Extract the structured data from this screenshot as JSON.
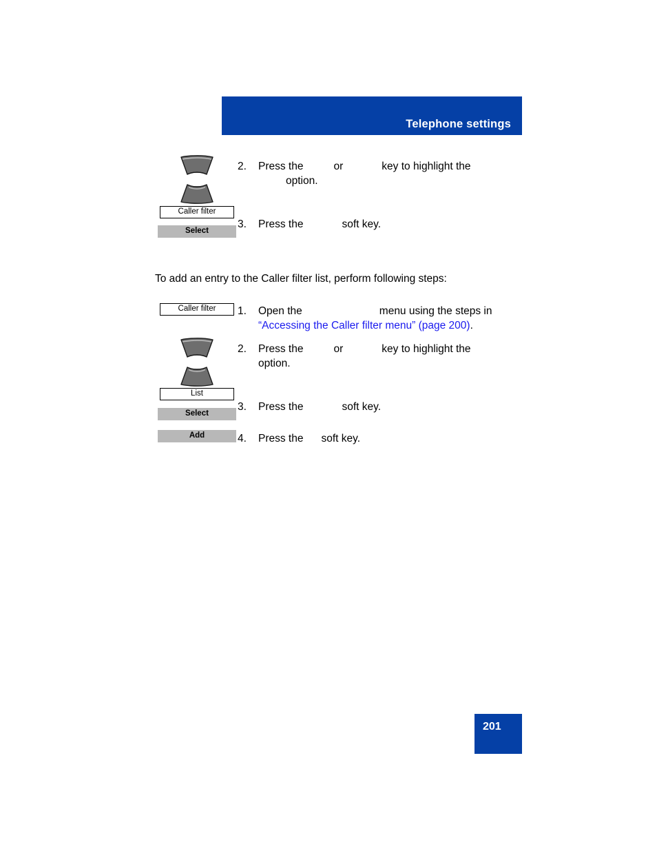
{
  "header": {
    "title": "Telephone settings",
    "band_color": "#0540a6"
  },
  "section_a": {
    "steps": [
      {
        "number": "2.",
        "line1_a": "Press the",
        "line1_b": "or",
        "line1_c": "key to highlight the",
        "line2": "option."
      },
      {
        "number": "3.",
        "line1_a": "Press the",
        "line1_b": "soft key."
      }
    ],
    "graphics": {
      "nav_up_icon": "navigation-up-key",
      "nav_down_icon": "navigation-down-key",
      "label_box": "Caller filter",
      "softkey": "Select"
    }
  },
  "intro_paragraph": "To add an entry to the Caller filter list, perform following steps:",
  "section_b": {
    "steps": [
      {
        "number": "1.",
        "line1_a": "Open the",
        "line1_b": "menu using the steps in",
        "line2_link": "“Accessing the Caller filter menu” (page 200)",
        "line2_tail": "."
      },
      {
        "number": "2.",
        "line1_a": "Press the",
        "line1_b": "or",
        "line1_c": "key to highlight the",
        "line2": "option."
      },
      {
        "number": "3.",
        "line1_a": "Press the",
        "line1_b": "soft key."
      },
      {
        "number": "4.",
        "line1_a": "Press the",
        "line1_b": "soft key."
      }
    ],
    "graphics": {
      "label_box_caller_filter": "Caller filter",
      "nav_up_icon": "navigation-up-key",
      "nav_down_icon": "navigation-down-key",
      "label_box_list": "List",
      "softkey_select": "Select",
      "softkey_add": "Add"
    }
  },
  "footer": {
    "page_number": "201",
    "block_color": "#0540a6"
  },
  "colors": {
    "brand_blue": "#0540a6",
    "link_blue": "#1a1aee",
    "softkey_gray": "#b8b8b8"
  }
}
